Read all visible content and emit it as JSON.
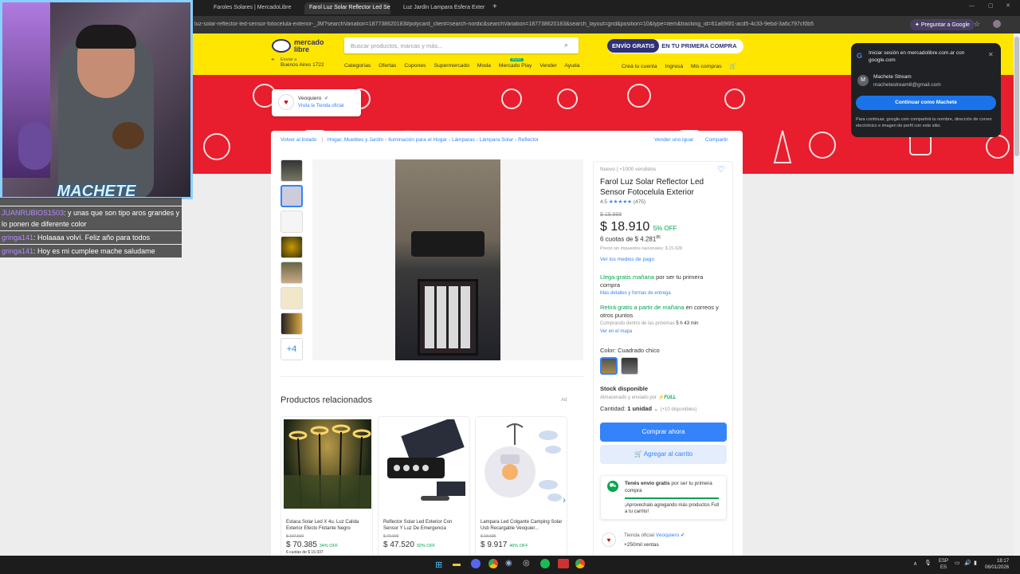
{
  "tabs": [
    {
      "label": "Faroles Solares | MercadoLibre"
    },
    {
      "label": "Farol Luz Solar Reflector Led Se"
    },
    {
      "label": "Luz Jardin Lampara Esfera Exter"
    }
  ],
  "address": {
    "url": "luz-solar-reflector-led-sensor-fotocelula-exterior-_JM?searchVariation=187738620183#polycard_client=search-nordic&searchVariation=187738620183&search_layout=grid&position=10&type=item&tracking_id=61a696f1-acd5-4c33-9ebd-3a6c797cf0b5",
    "ask_google": "Preguntar a Google"
  },
  "overlay": {
    "streamer_name": "MACHETE",
    "chat": [
      {
        "user": "",
        "text": ""
      },
      {
        "user": "JUANRUBIOS1503",
        "text": ": y unas que son tipo aros grandes y lo ponen de diferente color"
      },
      {
        "user": "gringa141",
        "text": ": Holaaaa volví. Feliz año para todos"
      },
      {
        "user": "gringa141",
        "text": ": Hoy es mi cumplee mache saludame"
      }
    ]
  },
  "header": {
    "logo": "mercado libre",
    "search_placeholder": "Buscar productos, marcas y más...",
    "promo_free": "ENVÍO GRATIS",
    "promo_rest": "EN TU PRIMERA COMPRA",
    "location_label": "Enviar a",
    "location": "Buenos Aires 1722",
    "nav": [
      "Categorías",
      "Ofertas",
      "Cupones",
      "Supermercado",
      "Moda",
      "Mercado Play",
      "Vender",
      "Ayuda"
    ],
    "new_badge": "GRATIS",
    "account": [
      "Creá tu cuenta",
      "Ingresá",
      "Mis compras"
    ]
  },
  "store": {
    "name": "Veoquiero",
    "link": "Visita la Tienda oficial"
  },
  "breadcrumb": {
    "back": "Volver al listado",
    "items": [
      "Hogar, Muebles y Jardín",
      "Iluminación para el Hogar",
      "Lámparas",
      "Lámpara Solar",
      "Reflector"
    ],
    "sell_same": "Vender uno igual",
    "share": "Compartir"
  },
  "gallery": {
    "more_count": "+4"
  },
  "product": {
    "condition": "Nuevo",
    "sold": "+1000 vendidos",
    "title": "Farol Luz Solar Reflector Led Sensor Fotocelula Exterior",
    "rating": "4.5",
    "reviews": "(475)",
    "old_price": "$ 19.999",
    "price": "$ 18.910",
    "discount": "5% OFF",
    "installments_pre": "6 cuotas de",
    "installments_amount": "$ 4.281",
    "installments_cents": "85",
    "taxes": "Precio sin impuestos nacionales: $ 15.628",
    "payment_link": "Ver los medios de pago",
    "ship_green": "Llega gratis mañana",
    "ship_rest": "por ser tu primera compra",
    "ship_link": "Más detalles y formas de entrega",
    "pickup_green": "Retirá gratis a partir de mañana",
    "pickup_rest": "en correos y otros puntos",
    "pickup_time": "Comprando dentro de las próximas",
    "pickup_hours": "5 h 43 min",
    "map_link": "Ver en el mapa",
    "color_label": "Color:",
    "color_value": "Cuadrado chico",
    "stock": "Stock disponible",
    "stored": "Almacenado y enviado por",
    "full": "FULL",
    "qty_label": "Cantidad:",
    "qty_value": "1 unidad",
    "qty_avail": "(+10 disponibles)",
    "buy_now": "Comprar ahora",
    "add_cart": "Agregar al carrito",
    "free_ship_title": "Tenés envío gratis",
    "free_ship_rest": "por ser tu primera compra",
    "free_ship_sub": "¡Aprovechalo agregando más productos Full a tu carrito!",
    "official_store_label": "Tienda oficial",
    "official_store": "Veoquiero",
    "sales": "+250mil ventas"
  },
  "related": {
    "title": "Productos relacionados",
    "ad": "Ad",
    "items": [
      {
        "name": "Estaca Solar Led X 4u. Luz Calida Exterior Efecto Flotante Negro",
        "old": "$ 107.500",
        "price": "$ 70.385",
        "discount": "34% OFF",
        "inst": "6 cuotas de $ 15.937"
      },
      {
        "name": "Reflector Solar Led Exterior Con Sensor Y Luz De Emergencia",
        "old": "$ 70.000",
        "price": "$ 47.520",
        "discount": "32% OFF",
        "inst": ""
      },
      {
        "name": "Lampara Led Colgante Camping Solar Usb Recargable Veoquier...",
        "old": "$ 18.635",
        "price": "$ 9.917",
        "discount": "46% OFF",
        "inst": ""
      }
    ]
  },
  "google": {
    "title": "Iniciar sesión en mercadolibre.com.ar con google.com",
    "name": "Machete Stream",
    "email": "machetestream8@gmail.com",
    "button": "Continuar como Machete",
    "note": "Para continuar, google.com compartirá tu nombre, dirección de correo electrónico e imagen de perfil con este sitio."
  },
  "taskbar": {
    "lang1": "ESP",
    "lang2": "ES",
    "time": "18:17",
    "date": "06/01/2026"
  }
}
